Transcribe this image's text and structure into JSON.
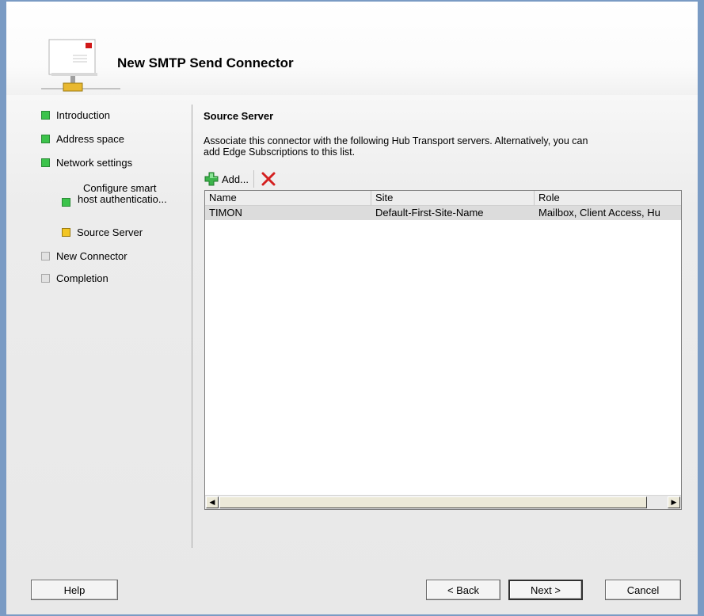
{
  "dialog": {
    "title": "New SMTP Send Connector"
  },
  "nav": [
    {
      "label": "Introduction",
      "status": "completed"
    },
    {
      "label": "Address space",
      "status": "completed"
    },
    {
      "label": "Network settings",
      "status": "completed"
    },
    {
      "label_line1": "Configure smart",
      "label_line2": "host authenticatio...",
      "status": "completed"
    },
    {
      "label": "Source Server",
      "status": "current"
    },
    {
      "label": "New Connector",
      "status": "pending"
    },
    {
      "label": "Completion",
      "status": "pending"
    }
  ],
  "status_colors": {
    "completed": "#3cc34b",
    "current": "#f2c523",
    "pending": "#e2e2e2"
  },
  "page": {
    "heading": "Source Server",
    "description_line1": "Associate this connector with the following Hub Transport servers. Alternatively, you can",
    "description_line2": "add Edge Subscriptions to this list."
  },
  "toolbar": {
    "add_label": "Add...",
    "add_icon": "green-plus-icon",
    "delete_icon": "red-x-icon"
  },
  "table": {
    "columns": [
      "Name",
      "Site",
      "Role"
    ],
    "rows": [
      {
        "name": "TIMON",
        "site": "Default-First-Site-Name",
        "role": "Mailbox, Client Access, Hu"
      }
    ]
  },
  "buttons": {
    "help": "Help",
    "back": "< Back",
    "next": "Next >",
    "cancel": "Cancel"
  }
}
